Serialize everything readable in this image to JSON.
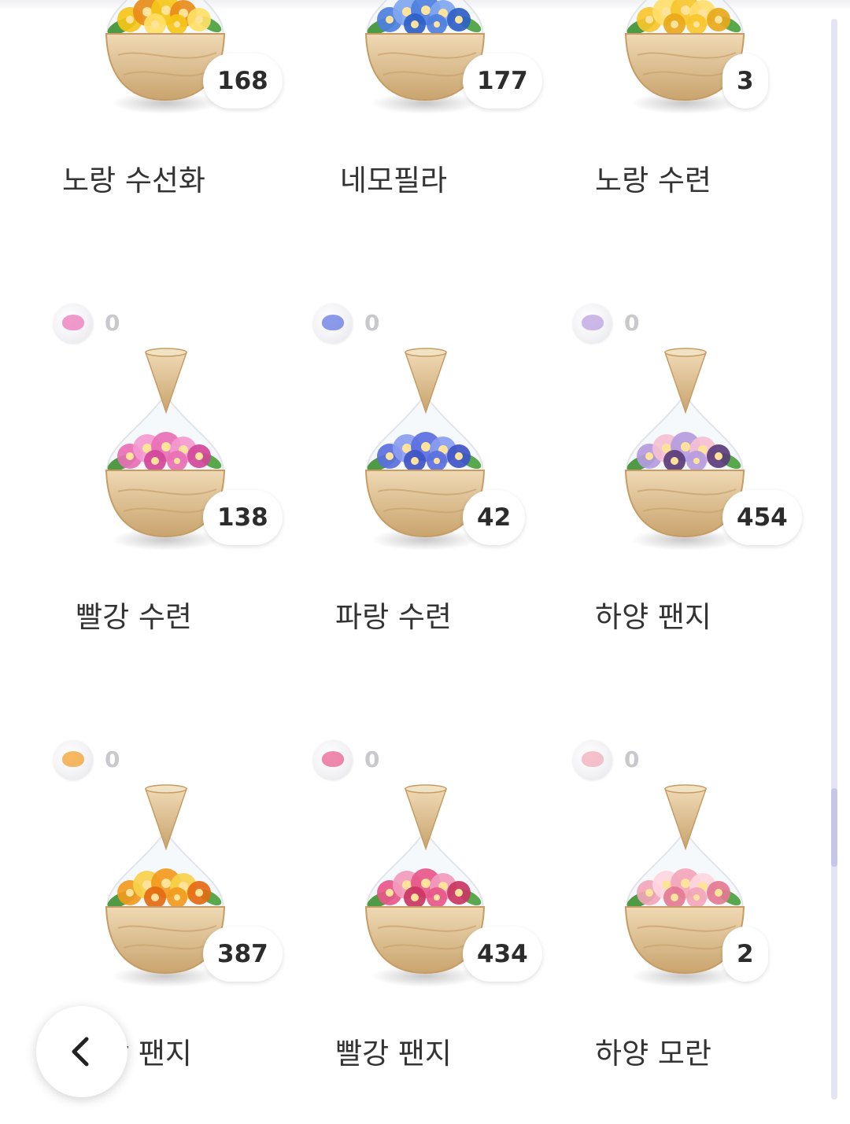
{
  "flowers": [
    {
      "name": "노랑 수선화",
      "count": "168",
      "seed_count": "",
      "colors": [
        "#f5c518",
        "#e88b1a",
        "#ffe066"
      ]
    },
    {
      "name": "네모필라",
      "count": "177",
      "seed_count": "",
      "colors": [
        "#4d7fe0",
        "#7fa6f0",
        "#2f5fc7"
      ]
    },
    {
      "name": "노랑 수련",
      "count": "3",
      "seed_count": "",
      "colors": [
        "#f7c52c",
        "#ffde6b",
        "#e8a81a"
      ]
    },
    {
      "name": "빨강 수련",
      "count": "138",
      "seed_count": "0",
      "colors": [
        "#e96fb6",
        "#f39ad0",
        "#d1479a"
      ]
    },
    {
      "name": "파랑 수련",
      "count": "42",
      "seed_count": "0",
      "colors": [
        "#5a6fe0",
        "#8a9cf0",
        "#3f54c7"
      ]
    },
    {
      "name": "하양 팬지",
      "count": "454",
      "seed_count": "0",
      "colors": [
        "#b59be0",
        "#f4c0d2",
        "#5a3c7a"
      ]
    },
    {
      "name": "노랑 팬지",
      "count": "387",
      "seed_count": "0",
      "colors": [
        "#f29a1e",
        "#f7d14a",
        "#e46a12"
      ]
    },
    {
      "name": "빨강 팬지",
      "count": "434",
      "seed_count": "0",
      "colors": [
        "#e8578a",
        "#f29bbd",
        "#c93664"
      ]
    },
    {
      "name": "하양 모란",
      "count": "2",
      "seed_count": "0",
      "colors": [
        "#f2a6b8",
        "#ffd6e0",
        "#e47a94"
      ]
    }
  ],
  "icons": {
    "back": "chevron-left-icon",
    "seed": "seed-icon",
    "pot": "flower-pot-icon"
  },
  "theme": {
    "scroll_track": "#e4e4f4",
    "scroll_thumb": "#c6c6ea",
    "wood": "#d9b98a"
  }
}
